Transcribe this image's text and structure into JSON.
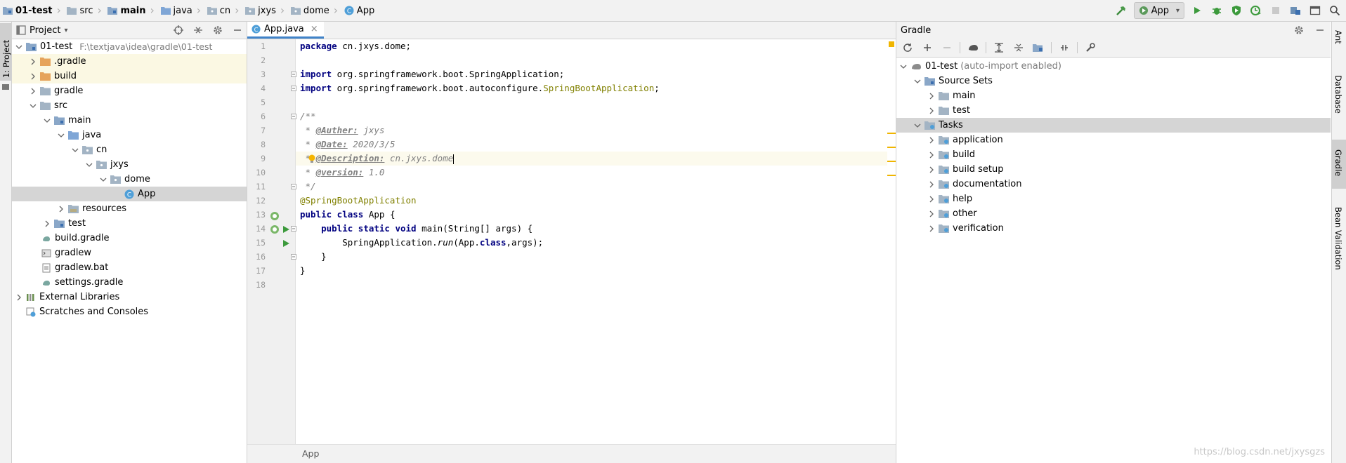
{
  "breadcrumb": [
    "01-test",
    "src",
    "main",
    "java",
    "cn",
    "jxys",
    "dome",
    "App"
  ],
  "run_config": {
    "label": "App"
  },
  "left_stripe": {
    "project_tab": "1: Project"
  },
  "project_panel": {
    "title": "Project",
    "rows": [
      {
        "label": "01-test",
        "path": "F:\\textjava\\idea\\gradle\\01-test"
      },
      {
        "label": ".gradle"
      },
      {
        "label": "build"
      },
      {
        "label": "gradle"
      },
      {
        "label": "src"
      },
      {
        "label": "main"
      },
      {
        "label": "java"
      },
      {
        "label": "cn"
      },
      {
        "label": "jxys"
      },
      {
        "label": "dome"
      },
      {
        "label": "App"
      },
      {
        "label": "resources"
      },
      {
        "label": "test"
      },
      {
        "label": "build.gradle"
      },
      {
        "label": "gradlew"
      },
      {
        "label": "gradlew.bat"
      },
      {
        "label": "settings.gradle"
      },
      {
        "label": "External Libraries"
      },
      {
        "label": "Scratches and Consoles"
      }
    ]
  },
  "editor": {
    "tab_label": "App.java",
    "line_numbers": [
      "1",
      "2",
      "3",
      "4",
      "5",
      "6",
      "7",
      "8",
      "9",
      "10",
      "11",
      "12",
      "13",
      "14",
      "15",
      "16",
      "17",
      "18"
    ],
    "code": {
      "l1_kw": "package",
      "l1_rest": " cn.jxys.dome;",
      "l3_kw": "import",
      "l3_rest": " org.springframework.boot.SpringApplication;",
      "l4_kw": "import",
      "l4_rest": " org.springframework.boot.autoconfigure.",
      "l4_ann": "SpringBootApplication",
      "l4_end": ";",
      "l6": "/**",
      "l7_pre": " * ",
      "l7_tag": "@Auther:",
      "l7_val": " jxys",
      "l8_pre": " * ",
      "l8_tag": "@Date:",
      "l8_val": " 2020/3/5",
      "l9_pre": " * ",
      "l9_tag": "@Description:",
      "l9_val": " cn.jxys.dome",
      "l10_pre": " * ",
      "l10_tag": "@version:",
      "l10_val": " 1.0",
      "l11": " */",
      "l12": "@SpringBootApplication",
      "l13_kw": "public class",
      "l13_rest": " App {",
      "l14_indent": "    ",
      "l14_kw": "public static void",
      "l14_rest": " main(String[] args) {",
      "l15_a": "        SpringApplication.",
      "l15_b": "run",
      "l15_c": "(App.",
      "l15_d": "class",
      "l15_e": ",args);",
      "l16": "    }",
      "l17": "}"
    },
    "footer_label": "App"
  },
  "gradle_panel": {
    "title": "Gradle",
    "rows": [
      {
        "label": "01-test",
        "note": "(auto-import enabled)"
      },
      {
        "label": "Source Sets"
      },
      {
        "label": "main"
      },
      {
        "label": "test"
      },
      {
        "label": "Tasks"
      },
      {
        "label": "application"
      },
      {
        "label": "build"
      },
      {
        "label": "build setup"
      },
      {
        "label": "documentation"
      },
      {
        "label": "help"
      },
      {
        "label": "other"
      },
      {
        "label": "verification"
      }
    ]
  },
  "right_stripe": {
    "tabs": [
      "Ant",
      "Database",
      "Gradle",
      "Bean Validation"
    ]
  },
  "watermark": "https://blog.csdn.net/jxysgzs",
  "colors": {
    "accent": "#4083c9",
    "keyword": "#000080",
    "annotation": "#808000",
    "doc": "#808080",
    "highlight": "#fbf8e3",
    "selection": "#d5d5d5"
  }
}
